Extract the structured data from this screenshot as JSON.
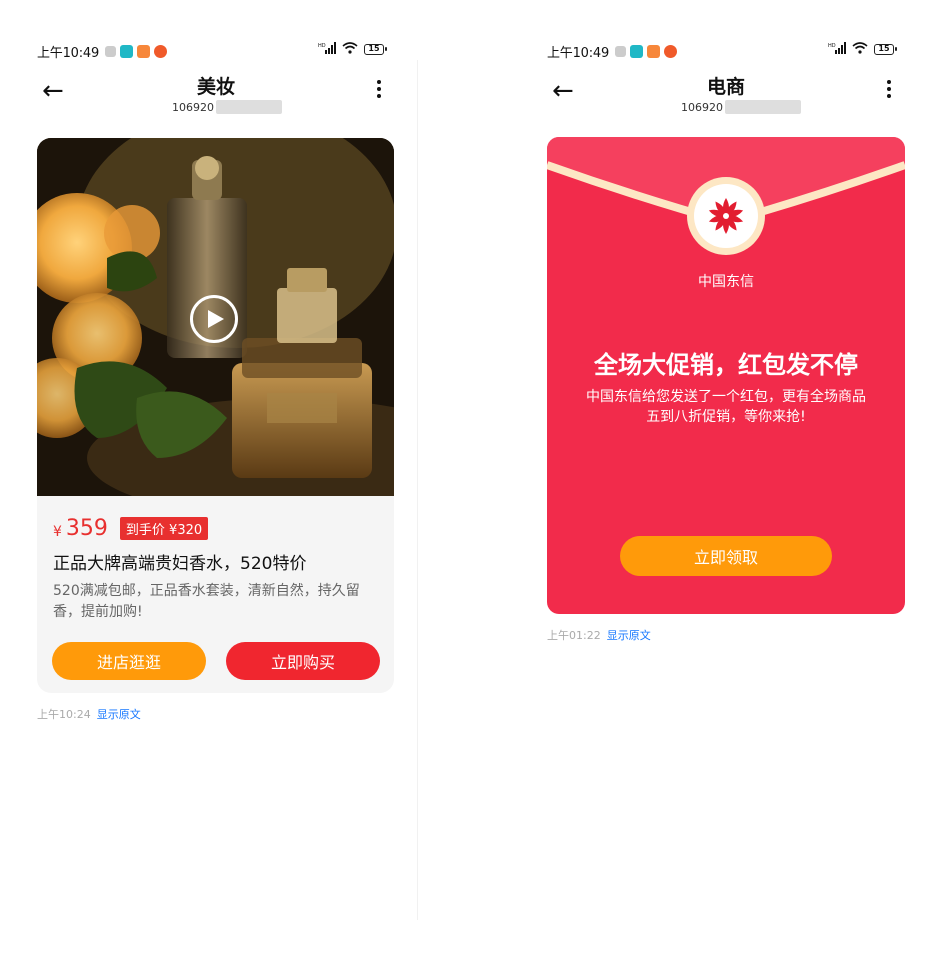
{
  "left": {
    "status": {
      "time": "上午10:49",
      "battery": "15",
      "network": "HD"
    },
    "header": {
      "title": "美妆",
      "number": "106920"
    },
    "card": {
      "price_symbol": "¥",
      "price": "359",
      "tag": "到手价 ¥320",
      "title": "正品大牌高端贵妇香水，520特价",
      "description": "520满减包邮，正品香水套装，清新自然，持久留香，提前加购!",
      "btn_store": "进店逛逛",
      "btn_buy": "立即购买"
    },
    "meta": {
      "time": "上午10:24",
      "link": "显示原文"
    }
  },
  "right": {
    "status": {
      "time": "上午10:49",
      "battery": "15",
      "network": "HD"
    },
    "header": {
      "title": "电商",
      "number": "106920"
    },
    "card": {
      "brand": "中国东信",
      "headline": "全场大促销，红包发不停",
      "description": "中国东信给您发送了一个红包，更有全场商品五到八折促销，等你来抢!",
      "btn_claim": "立即领取"
    },
    "meta": {
      "time": "上午01:22",
      "link": "显示原文"
    }
  },
  "colors": {
    "accent_red": "#f0262f",
    "envelope_red": "#f22b4b",
    "orange": "#ff9a0a",
    "link_blue": "#1677ff"
  }
}
